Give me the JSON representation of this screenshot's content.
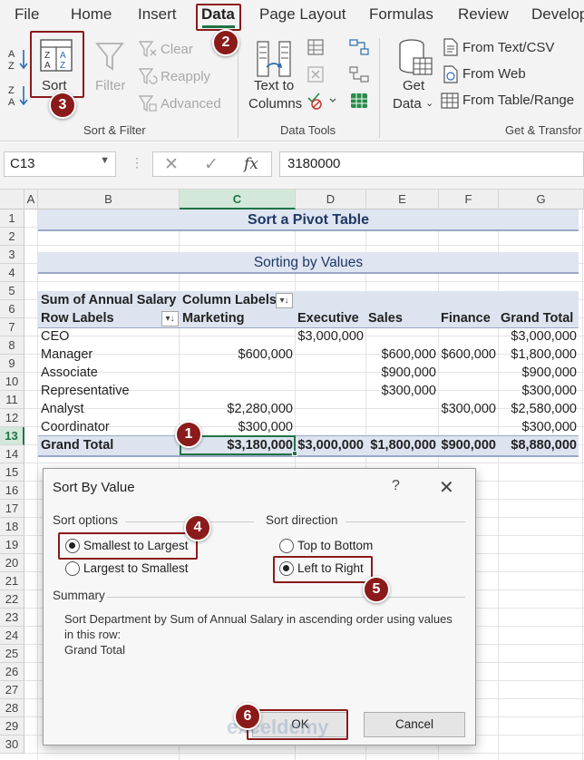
{
  "ribbon_tabs": [
    "File",
    "Home",
    "Insert",
    "Data",
    "Page Layout",
    "Formulas",
    "Review",
    "Develop"
  ],
  "active_tab": "Data",
  "sort_filter": {
    "sort_label": "Sort",
    "filter_label": "Filter",
    "clear_label": "Clear",
    "reapply_label": "Reapply",
    "advanced_label": "Advanced",
    "group_label": "Sort & Filter"
  },
  "data_tools": {
    "text_to_columns_line1": "Text to",
    "text_to_columns_line2": "Columns",
    "group_label": "Data Tools"
  },
  "get_transform": {
    "get_data_line1": "Get",
    "get_data_line2": "Data",
    "from_text_csv": "From Text/CSV",
    "from_web": "From Web",
    "from_table_range": "From Table/Range",
    "group_label": "Get & Transfor"
  },
  "formula_bar": {
    "name_box": "C13",
    "fx_label": "fx",
    "formula": "3180000"
  },
  "grid": {
    "column_headers": [
      "A",
      "B",
      "C",
      "D",
      "E",
      "F",
      "G"
    ],
    "selected_column": "C",
    "row_numbers": [
      "1",
      "2",
      "3",
      "4",
      "5",
      "6",
      "7",
      "8",
      "9",
      "10",
      "11",
      "12",
      "13",
      "14",
      "15",
      "16",
      "17",
      "18",
      "19",
      "20",
      "21",
      "22",
      "23",
      "24",
      "25",
      "26",
      "27",
      "28",
      "29",
      "30"
    ],
    "selected_row": "13"
  },
  "sheet": {
    "title": "Sort a Pivot Table",
    "subtitle": "Sorting by Values"
  },
  "pivot": {
    "values_label": "Sum of Annual Salary",
    "column_labels": "Column Labels",
    "row_labels": "Row Labels",
    "columns": [
      "Marketing",
      "Executive",
      "Sales",
      "Finance",
      "Grand Total"
    ],
    "rows": [
      {
        "label": "CEO",
        "values": [
          "",
          "$3,000,000",
          "",
          "",
          "$3,000,000"
        ]
      },
      {
        "label": "Manager",
        "values": [
          "$600,000",
          "",
          "$600,000",
          "$600,000",
          "$1,800,000"
        ]
      },
      {
        "label": "Associate",
        "values": [
          "",
          "",
          "$900,000",
          "",
          "$900,000"
        ]
      },
      {
        "label": "Representative",
        "values": [
          "",
          "",
          "$300,000",
          "",
          "$300,000"
        ]
      },
      {
        "label": "Analyst",
        "values": [
          "$2,280,000",
          "",
          "",
          "$300,000",
          "$2,580,000"
        ]
      },
      {
        "label": "Coordinator",
        "values": [
          "$300,000",
          "",
          "",
          "",
          "$300,000"
        ]
      }
    ],
    "grand_total": {
      "label": "Grand Total",
      "values": [
        "$3,180,000",
        "$3,000,000",
        "$1,800,000",
        "$900,000",
        "$8,880,000"
      ]
    }
  },
  "dialog": {
    "title": "Sort By Value",
    "help": "?",
    "close": "✕",
    "sort_options_label": "Sort options",
    "option_smallest": "Smallest to Largest",
    "option_largest": "Largest to Smallest",
    "sort_direction_label": "Sort direction",
    "direction_top": "Top to Bottom",
    "direction_left": "Left to Right",
    "selected_option": "Smallest to Largest",
    "selected_direction": "Left to Right",
    "summary_label": "Summary",
    "summary_line1": "Sort Department by Sum of Annual Salary in ascending order using values",
    "summary_line2": "in this row:",
    "summary_line3": "Grand Total",
    "ok_label": "OK",
    "cancel_label": "Cancel"
  },
  "annotations": {
    "step1": "1",
    "step2": "2",
    "step3": "3",
    "step4": "4",
    "step5": "5",
    "step6": "6",
    "color": "#8b1a1a"
  },
  "watermark": "exceldemy"
}
